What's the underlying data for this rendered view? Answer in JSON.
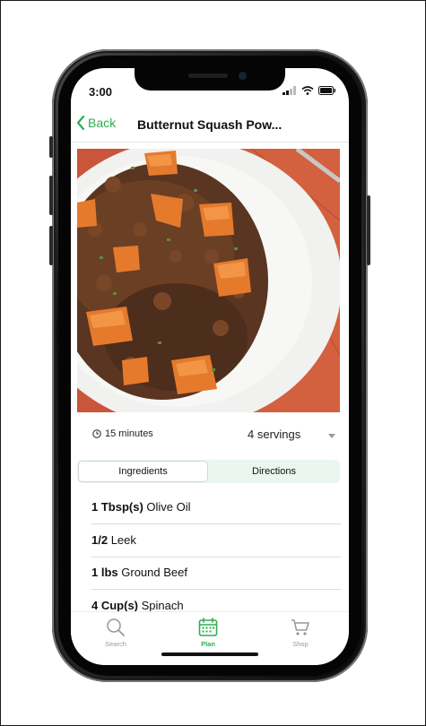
{
  "status_bar": {
    "time": "3:00"
  },
  "nav": {
    "back_label": "Back",
    "title": "Butternut Squash Pow..."
  },
  "photo": {
    "description_icon": "food-photo"
  },
  "meta": {
    "duration": "15 minutes",
    "servings": "4 servings"
  },
  "segments": {
    "ingredients": "Ingredients",
    "directions": "Directions"
  },
  "ingredients": [
    {
      "qty": "1 Tbsp(s)",
      "name": "Olive Oil"
    },
    {
      "qty": "1/2",
      "name": "Leek"
    },
    {
      "qty": "1 lbs",
      "name": "Ground Beef"
    },
    {
      "qty": "4 Cup(s)",
      "name": "Spinach"
    }
  ],
  "tabs": {
    "search": "Search",
    "plan": "Plan",
    "shop": "Shop"
  },
  "colors": {
    "accent": "#2eae4e",
    "segment_bg": "#eaf6ee"
  }
}
